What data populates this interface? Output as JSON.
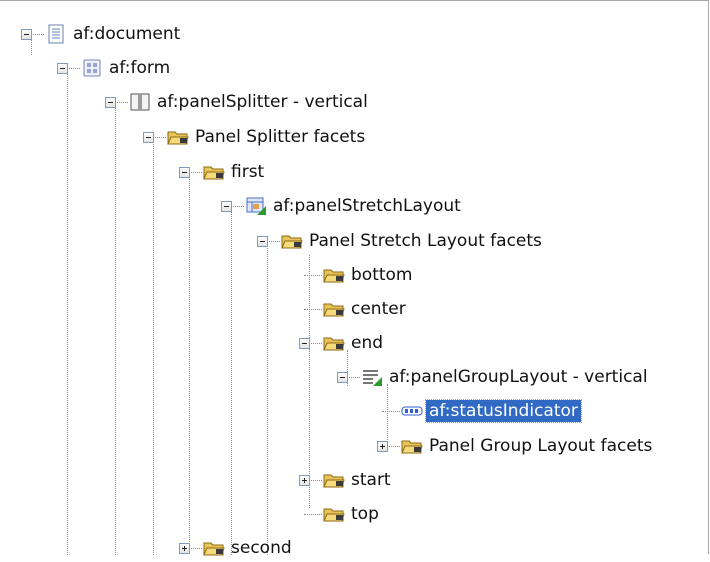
{
  "tree": {
    "nodes": [
      {
        "label": "af:document",
        "icon": "document-icon",
        "state": "expanded"
      },
      {
        "label": "af:form",
        "icon": "form-icon",
        "state": "expanded"
      },
      {
        "label": "af:panelSplitter - vertical",
        "icon": "panel-splitter-icon",
        "state": "expanded"
      },
      {
        "label": "Panel Splitter facets",
        "icon": "folder-icon",
        "state": "expanded"
      },
      {
        "label": "first",
        "icon": "folder-icon",
        "state": "expanded"
      },
      {
        "label": "af:panelStretchLayout",
        "icon": "panel-stretch-layout-icon",
        "state": "expanded"
      },
      {
        "label": "Panel Stretch Layout facets",
        "icon": "folder-icon",
        "state": "expanded"
      },
      {
        "label": "bottom",
        "icon": "folder-icon",
        "state": "leaf"
      },
      {
        "label": "center",
        "icon": "folder-icon",
        "state": "leaf"
      },
      {
        "label": "end",
        "icon": "folder-icon",
        "state": "expanded"
      },
      {
        "label": "af:panelGroupLayout - vertical",
        "icon": "panel-group-layout-icon",
        "state": "expanded"
      },
      {
        "label": "af:statusIndicator",
        "icon": "status-indicator-icon",
        "state": "leaf",
        "selected": true
      },
      {
        "label": "Panel Group Layout facets",
        "icon": "folder-icon",
        "state": "collapsed"
      },
      {
        "label": "start",
        "icon": "folder-icon",
        "state": "collapsed"
      },
      {
        "label": "top",
        "icon": "folder-icon",
        "state": "leaf"
      },
      {
        "label": "second",
        "icon": "folder-icon",
        "state": "collapsed"
      }
    ]
  }
}
